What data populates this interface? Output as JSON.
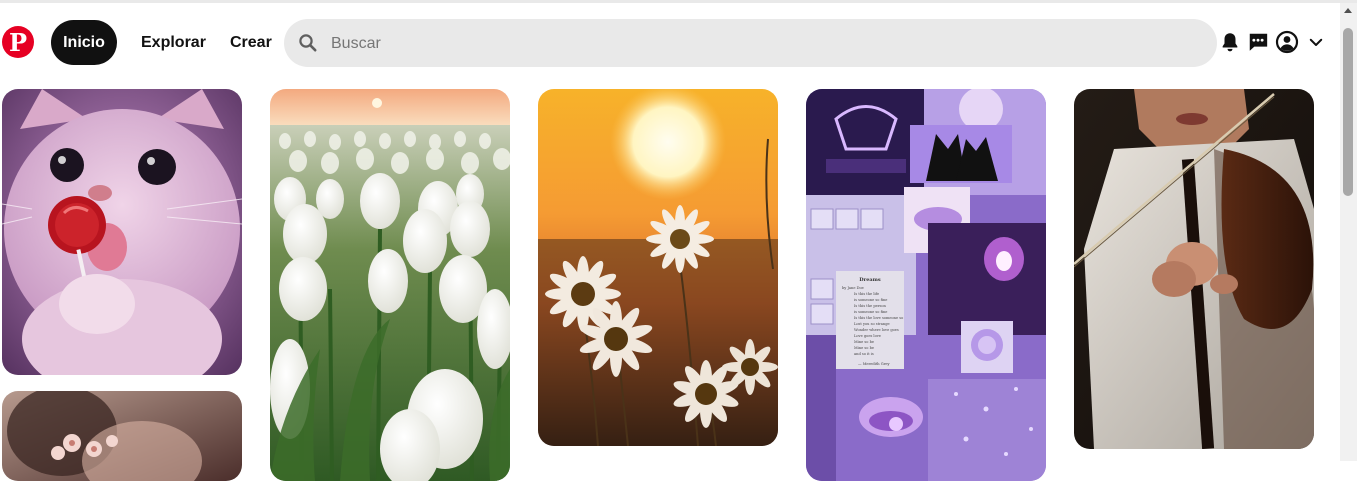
{
  "header": {
    "logo_letter": "P",
    "logo_icon": "pinterest-logo",
    "nav": {
      "home_label": "Inicio",
      "explore_label": "Explorar",
      "create_label": "Crear"
    },
    "search": {
      "placeholder": "Buscar",
      "value": "",
      "icon": "search-icon"
    },
    "icons": [
      "bell-icon",
      "message-icon",
      "account-icon",
      "chevron-down-icon"
    ]
  },
  "pins": [
    {
      "subject": "cat with red lollipop",
      "column": 1
    },
    {
      "subject": "white tulip field at sunset",
      "column": 2
    },
    {
      "subject": "daisies at sunset",
      "column": 3
    },
    {
      "subject": "purple aesthetic collage",
      "column": 4
    },
    {
      "subject": "person playing violin",
      "column": 5
    },
    {
      "subject": "portrait with flowers",
      "column": 1
    }
  ],
  "collage_poem": {
    "title": "Dreams",
    "lines": [
      "by Jane Doe",
      "Is this the life",
      "is someone so fine",
      "Is this the person",
      "is someone so fine",
      "Is this the love someone so",
      "Lost you so strange",
      "Wonder where love goes",
      "Love goes love",
      "Mine so be",
      "Mine so be",
      "and so it is"
    ],
    "author": "— Meredith Grey"
  },
  "colors": {
    "brand": "#e60023",
    "nav_active_bg": "#111111",
    "search_bg": "#e9e9e9"
  }
}
